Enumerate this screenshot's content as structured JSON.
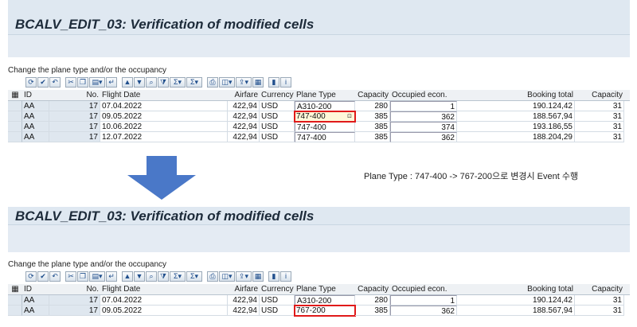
{
  "panel1": {
    "title": "BCALV_EDIT_03: Verification of modified cells",
    "section_label": "Change the plane type and/or the occupancy",
    "headers": [
      "ID",
      "No.",
      "Flight Date",
      "Airfare",
      "Currency",
      "Plane Type",
      "Capacity",
      "Occupied econ.",
      "Booking total",
      "Capacity"
    ],
    "rows": [
      {
        "id": "AA",
        "no": "17",
        "date": "07.04.2022",
        "airfare": "422,94",
        "currency": "USD",
        "plane": "A310-200",
        "capacity": "280",
        "occupied": "1",
        "booking": "190.124,42",
        "capacity2": "31"
      },
      {
        "id": "AA",
        "no": "17",
        "date": "09.05.2022",
        "airfare": "422,94",
        "currency": "USD",
        "plane": "747-400",
        "capacity": "385",
        "occupied": "362",
        "booking": "188.567,94",
        "capacity2": "31"
      },
      {
        "id": "AA",
        "no": "17",
        "date": "10.06.2022",
        "airfare": "422,94",
        "currency": "USD",
        "plane": "747-400",
        "capacity": "385",
        "occupied": "374",
        "booking": "193.186,55",
        "capacity2": "31"
      },
      {
        "id": "AA",
        "no": "17",
        "date": "12.07.2022",
        "airfare": "422,94",
        "currency": "USD",
        "plane": "747-400",
        "capacity": "385",
        "occupied": "362",
        "booking": "188.204,29",
        "capacity2": "31"
      }
    ]
  },
  "note": "Plane Type : 747-400 -> 767-200으로 변경시 Event 수행",
  "panel2": {
    "title": "BCALV_EDIT_03: Verification of modified cells",
    "section_label": "Change the plane type and/or the occupancy",
    "headers": [
      "ID",
      "No.",
      "Flight Date",
      "Airfare",
      "Currency",
      "Plane Type",
      "Capacity",
      "Occupied econ.",
      "Booking total",
      "Capacity"
    ],
    "rows": [
      {
        "id": "AA",
        "no": "17",
        "date": "07.04.2022",
        "airfare": "422,94",
        "currency": "USD",
        "plane": "A310-200",
        "capacity": "280",
        "occupied": "1",
        "booking": "190.124,42",
        "capacity2": "31"
      },
      {
        "id": "AA",
        "no": "17",
        "date": "09.05.2022",
        "airfare": "422,94",
        "currency": "USD",
        "plane": "767-200",
        "capacity": "385",
        "occupied": "362",
        "booking": "188.567,94",
        "capacity2": "31"
      }
    ]
  },
  "colors": {
    "highlight": "#e01a1a",
    "arrow": "#4a78c8",
    "title_band": "#dfe8f1"
  },
  "toolbar_icons": [
    "refresh-icon",
    "check-icon",
    "undo-icon",
    "cut-icon",
    "copy-icon",
    "paste-icon",
    "insert-row-icon",
    "sort-asc-icon",
    "sort-desc-icon",
    "find-icon",
    "filter-icon",
    "sum-icon",
    "subtotal-icon",
    "print-icon",
    "view-icon",
    "export-icon",
    "layout-icon",
    "graphic-icon",
    "info-icon"
  ]
}
